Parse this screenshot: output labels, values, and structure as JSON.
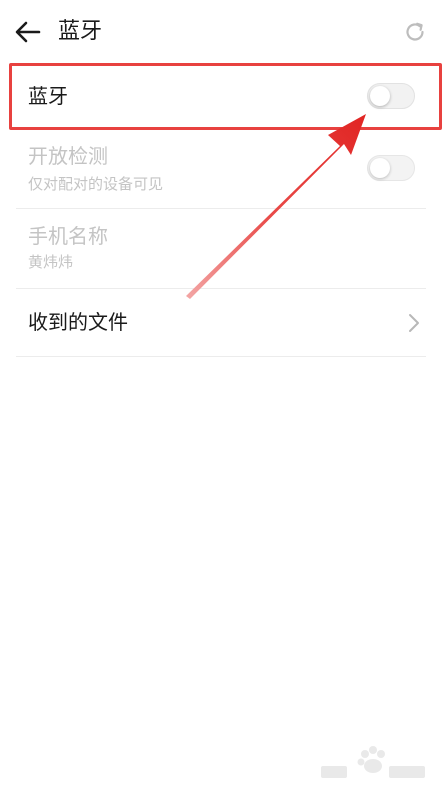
{
  "header": {
    "title": "蓝牙",
    "back_icon": "back-arrow-icon",
    "refresh_icon": "refresh-icon"
  },
  "settings": {
    "bluetooth": {
      "label": "蓝牙",
      "enabled": false
    },
    "open_detection": {
      "label": "开放检测",
      "sublabel": "仅对配对的设备可见",
      "enabled": false
    },
    "device_name": {
      "label": "手机名称",
      "value": "黄炜炜"
    },
    "received_files": {
      "label": "收到的文件"
    }
  },
  "annotation": {
    "highlight_color": "#e8413f",
    "arrow_color": "#e8413f"
  },
  "watermark": {
    "icon": "baidu-jingyan-logo"
  }
}
